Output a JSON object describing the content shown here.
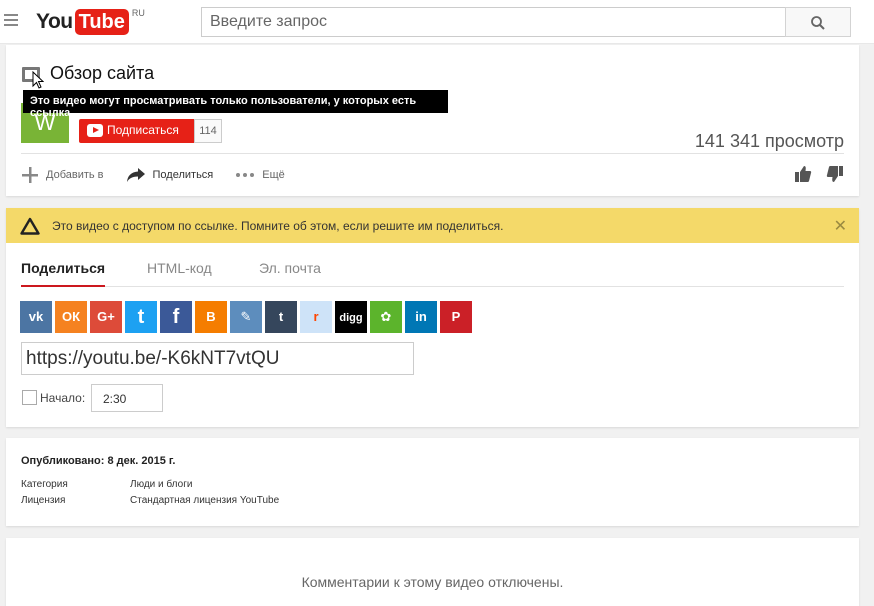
{
  "masthead": {
    "logo_you": "You",
    "logo_tube": "Tube",
    "logo_region": "RU",
    "search_placeholder": "Введите запрос"
  },
  "video": {
    "title": "Обзор сайта",
    "tooltip": "Это видео могут просматривать только пользователи, у которых есть ссылка.",
    "channel_avatar_letter": "W",
    "subscribe_label": "Подписаться",
    "subscriber_count": "114",
    "views": "141 341 просмотр",
    "actions": {
      "add_to": "Добавить в",
      "share": "Поделиться",
      "more": "Ещё"
    }
  },
  "share": {
    "banner": "Это видео с доступом по ссылке. Помните об этом, если решите им поделиться.",
    "tabs": [
      "Поделиться",
      "HTML-код",
      "Эл. почта"
    ],
    "networks": [
      {
        "name": "vk",
        "glyph": "vk",
        "color": "#4c75a3"
      },
      {
        "name": "odnoklassniki",
        "glyph": "ОК",
        "color": "#f58220"
      },
      {
        "name": "google-plus",
        "glyph": "G+",
        "color": "#dd4b39"
      },
      {
        "name": "twitter",
        "glyph": "t",
        "color": "#1da1f2"
      },
      {
        "name": "facebook",
        "glyph": "f",
        "color": "#3b5998"
      },
      {
        "name": "blogger",
        "glyph": "B",
        "color": "#f57d00"
      },
      {
        "name": "livejournal",
        "glyph": "✎",
        "color": "#5d8dbd"
      },
      {
        "name": "tumblr",
        "glyph": "t",
        "color": "#35465c"
      },
      {
        "name": "reddit",
        "glyph": "r",
        "color": "#cee3f8"
      },
      {
        "name": "digg",
        "glyph": "digg",
        "color": "#000000"
      },
      {
        "name": "mixi",
        "glyph": "✿",
        "color": "#5cb42c"
      },
      {
        "name": "linkedin",
        "glyph": "in",
        "color": "#0077b5"
      },
      {
        "name": "pinterest",
        "glyph": "P",
        "color": "#cb2027"
      }
    ],
    "link": "https://youtu.be/-K6kNT7vtQU",
    "start_label": "Начало:",
    "start_time": "2:30"
  },
  "description": {
    "published": "Опубликовано: 8 дек. 2015 г.",
    "category_label": "Категория",
    "category_value": "Люди и блоги",
    "license_label": "Лицензия",
    "license_value": "Стандартная лицензия YouTube"
  },
  "comments": {
    "disabled_text": "Комментарии к этому видео отключены."
  },
  "colors": {
    "brand_red": "#e62117",
    "banner_yellow": "#f4d969",
    "tab_underline": "#cc181e"
  }
}
